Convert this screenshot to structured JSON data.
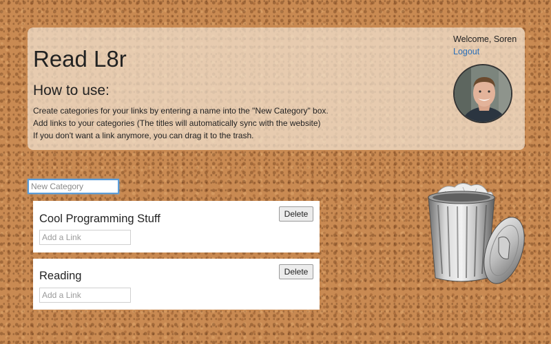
{
  "header": {
    "app_title": "Read L8r",
    "howto_title": "How to use:",
    "instructions": [
      "Create categories for your links by entering a name into the \"New Category\" box.",
      "Add links to your categories (The titles will automatically sync with the website)",
      "If you don't want a link anymore, you can drag it to the trash."
    ]
  },
  "user": {
    "welcome": "Welcome, Soren",
    "logout_label": "Logout"
  },
  "new_category": {
    "placeholder": "New Category",
    "value": ""
  },
  "categories": [
    {
      "title": "Cool Programming Stuff",
      "delete_label": "Delete",
      "link_placeholder": "Add a Link"
    },
    {
      "title": "Reading",
      "delete_label": "Delete",
      "link_placeholder": "Add a Link"
    }
  ],
  "icons": {
    "trash": "trash-can-icon",
    "avatar": "user-avatar"
  },
  "colors": {
    "link": "#2a6fb8",
    "focus_ring": "#5b9dd9",
    "cork": "#c98a52"
  }
}
